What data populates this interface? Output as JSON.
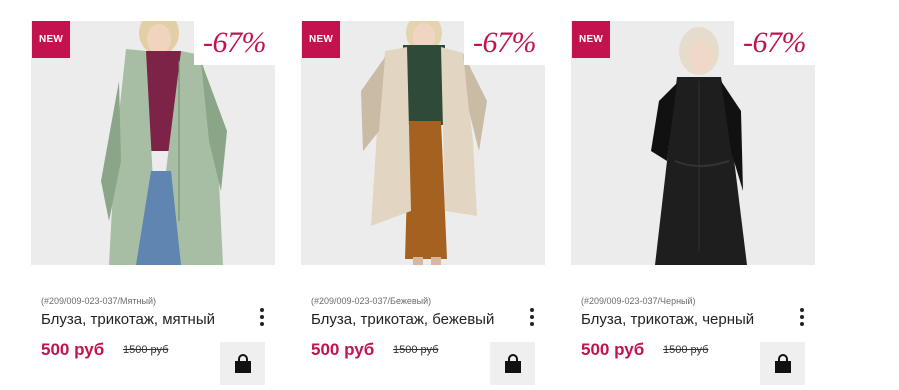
{
  "products": [
    {
      "badge_new": "NEW",
      "discount": "-67%",
      "sku": "(#209/009-023-037/Мятный)",
      "name": "Блуза, трикотаж, мятный",
      "price": "500 руб",
      "old_price": "1500 руб",
      "icons": [
        "more-vertical-icon",
        "shopping-bag-icon"
      ],
      "colors": {
        "coat": "#a7bea5",
        "coat_dark": "#8aa588",
        "top": "#7d2347",
        "jeans": "#5f85b0",
        "hair": "#e4cfa4"
      }
    },
    {
      "badge_new": "NEW",
      "discount": "-67%",
      "sku": "(#209/009-023-037/Бежевый)",
      "name": "Блуза, трикотаж, бежевый",
      "price": "500 руб",
      "old_price": "1500 руб",
      "icons": [
        "more-vertical-icon",
        "shopping-bag-icon"
      ],
      "colors": {
        "coat": "#e2d6c3",
        "coat_dark": "#c9bba4",
        "top": "#2f4a38",
        "skirt": "#a5611f",
        "hair": "#e5d3ad"
      }
    },
    {
      "badge_new": "NEW",
      "discount": "-67%",
      "sku": "(#209/009-023-037/Черный)",
      "name": "Блуза, трикотаж, черный",
      "price": "500 руб",
      "old_price": "1500 руб",
      "icons": [
        "more-vertical-icon",
        "shopping-bag-icon"
      ],
      "colors": {
        "coat": "#1e1e1e",
        "coat_dark": "#111111",
        "legs": "#2a2a2a",
        "hair": "#e6dccb"
      }
    }
  ],
  "theme": {
    "accent": "#c2134e",
    "photo_bg": "#ececec",
    "cart_bg": "#efefef"
  }
}
